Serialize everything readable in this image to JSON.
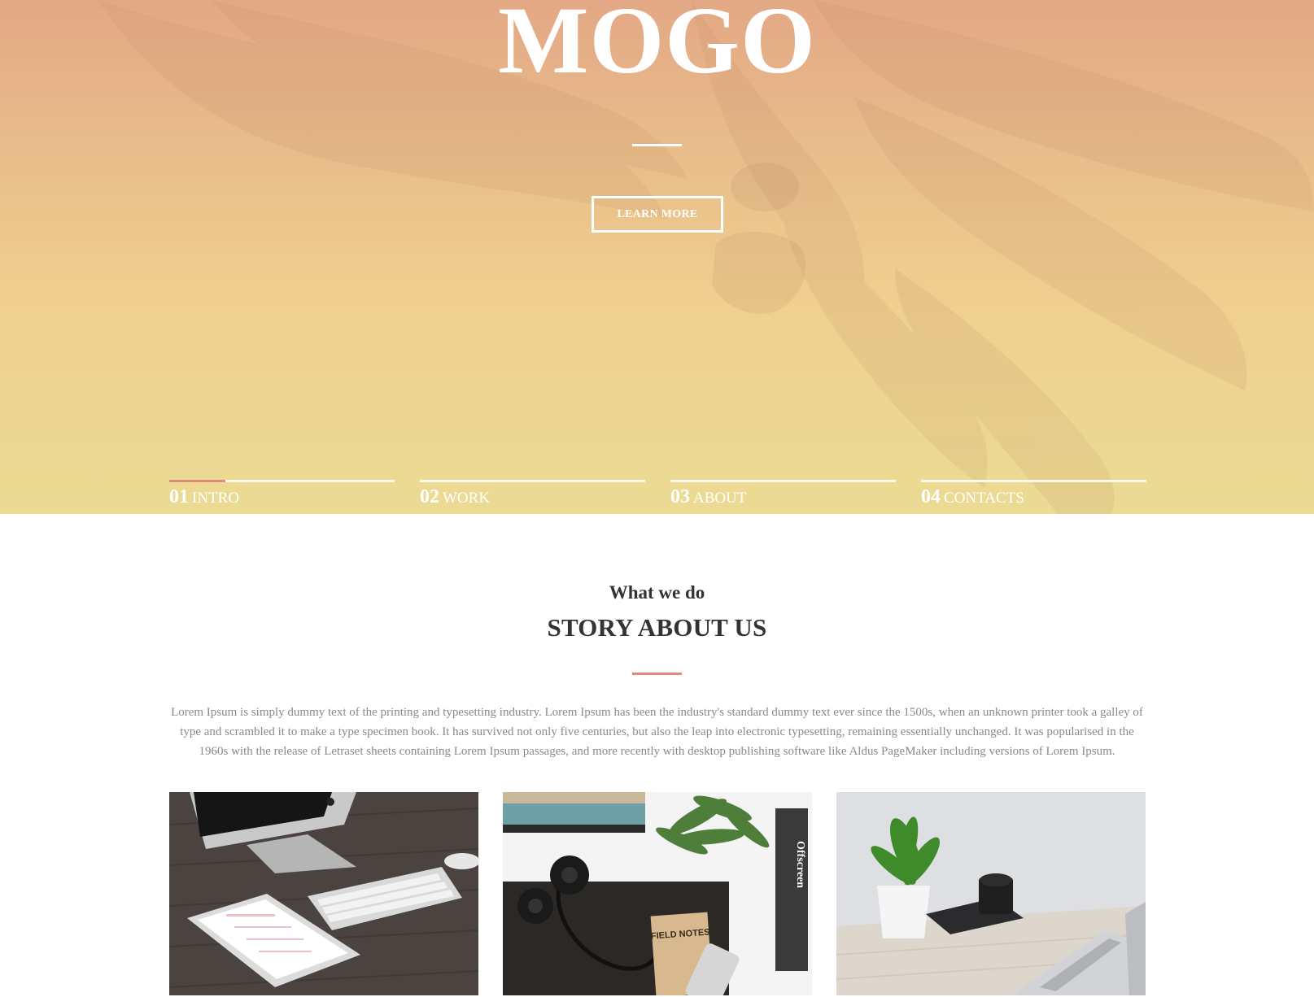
{
  "hero": {
    "title": "MOGO",
    "button_label": "LEARN MORE",
    "gradient_top": "#e3a885",
    "gradient_bottom": "#ebdb93"
  },
  "slider_nav": [
    {
      "num": "01",
      "label": "Intro",
      "active": true
    },
    {
      "num": "02",
      "label": "Work",
      "active": false
    },
    {
      "num": "03",
      "label": "About",
      "active": false
    },
    {
      "num": "04",
      "label": "Contacts",
      "active": false
    }
  ],
  "slider_progress": 0.25,
  "accent_color": "#e08a7c",
  "story": {
    "subtitle": "What we do",
    "title": "STORY ABOUT US",
    "text": "Lorem Ipsum is simply dummy text of the printing and typesetting industry. Lorem Ipsum has been the industry's standard dummy text ever since the 1500s, when an unknown printer took a galley of type and scrambled it to make a type specimen book. It has survived not only five centuries, but also the leap into electronic typesetting, remaining essentially unchanged. It was popularised in the 1960s with the release of Letraset sheets containing Lorem Ipsum passages, and more recently with desktop publishing software like Aldus PageMaker including versions of Lorem Ipsum."
  },
  "cards": [
    {
      "subject": "desk-imac-keyboard-tablet-photo"
    },
    {
      "subject": "desk-headphones-notebook-phone-photo",
      "notebook_text": "FIELD NOTES",
      "magazine_text": "Offscreen"
    },
    {
      "subject": "desk-plant-camera-laptop-photo"
    }
  ]
}
